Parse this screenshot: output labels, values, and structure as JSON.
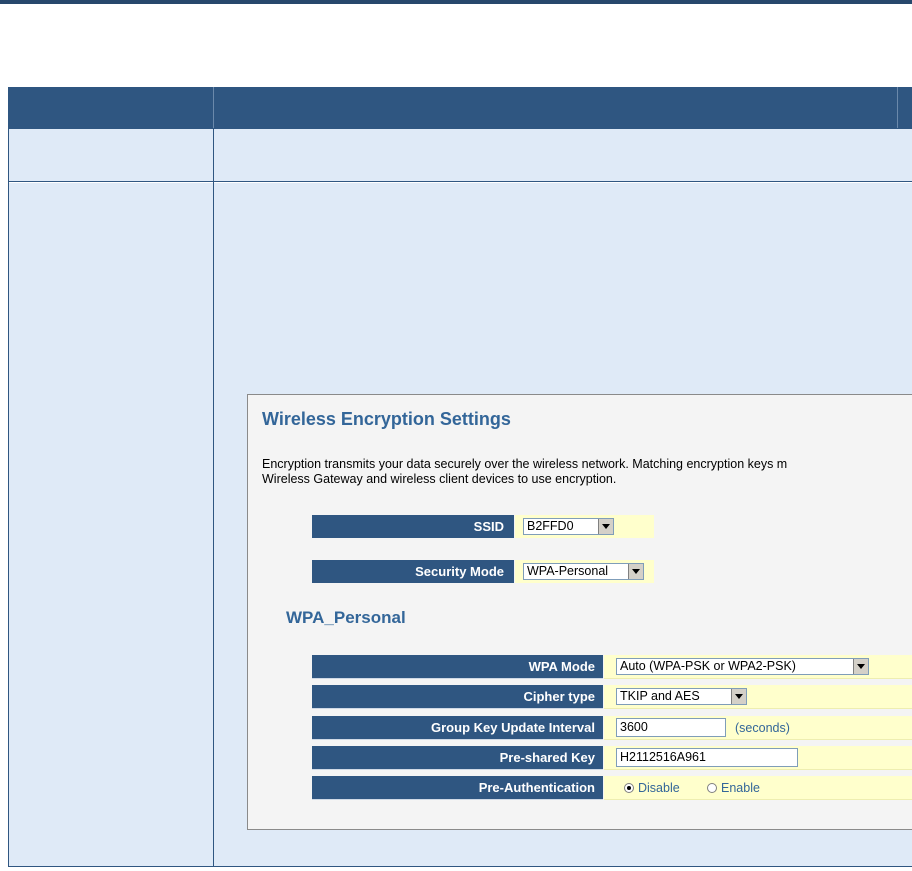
{
  "shot": {
    "title": "Wireless Encryption Settings",
    "description_line1": "Encryption transmits your data securely over the wireless network. Matching encryption keys m",
    "description_line2": "Wireless Gateway and wireless client devices to use encryption.",
    "ssid": {
      "label": "SSID",
      "value": "B2FFD0"
    },
    "security_mode": {
      "label": "Security Mode",
      "value": "WPA-Personal"
    },
    "section_title": "WPA_Personal",
    "wpa_mode": {
      "label": "WPA Mode",
      "value": "Auto (WPA-PSK or WPA2-PSK)"
    },
    "cipher_type": {
      "label": "Cipher type",
      "value": "TKIP and AES"
    },
    "group_key": {
      "label": "Group Key Update Interval",
      "value": "3600",
      "unit": "(seconds)"
    },
    "psk": {
      "label": "Pre-shared Key",
      "value": "H2112516A961"
    },
    "pre_auth": {
      "label": "Pre-Authentication",
      "option_disable": "Disable",
      "option_enable": "Enable",
      "selected": "Disable"
    }
  },
  "colors": {
    "header": "#2f5681",
    "cell_bg": "#dfeaf7",
    "value_bg": "#ffffcc",
    "title": "#336699"
  }
}
